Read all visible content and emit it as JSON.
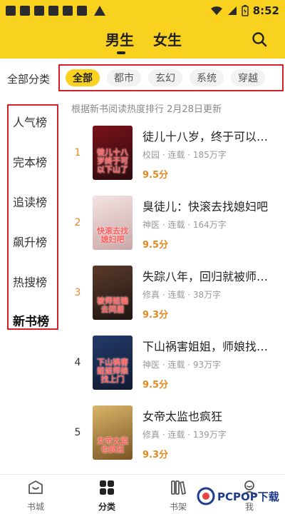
{
  "status_bar": {
    "time": "8:52"
  },
  "header": {
    "tabs": [
      {
        "label": "男生"
      },
      {
        "label": "女生"
      }
    ]
  },
  "categories": {
    "label": "全部分类",
    "chips": [
      "全部",
      "都市",
      "玄幻",
      "系统",
      "穿越"
    ],
    "active": "全部"
  },
  "sidebar": {
    "items": [
      "人气榜",
      "完本榜",
      "追读榜",
      "飙升榜",
      "热搜榜",
      "新书榜"
    ],
    "active": "新书榜"
  },
  "ranking": {
    "note": "根据新书阅读热度排行 2月28日更新",
    "books": [
      {
        "rank": "1",
        "title": "徒儿十八岁，终于可以下山了",
        "meta": "校园 · 连载 · 185万字",
        "score": "9.5分",
        "cover_text": "徒儿十八岁终于可以下山了",
        "cover_colors": [
          "#7a1118",
          "#2a0c10"
        ]
      },
      {
        "rank": "2",
        "title": "臭徒儿：快滚去找媳妇吧",
        "meta": "神医 · 连载 · 164万字",
        "score": "9.5分",
        "cover_text": "快滚去找媳妇吧",
        "cover_colors": [
          "#f4e3e3",
          "#c9a7a7"
        ]
      },
      {
        "rank": "3",
        "title": "失踪八年，回归就被师姐们宠上天",
        "meta": "修真 · 连载 · 38万字",
        "score": "9.3分",
        "cover_text": "被师姐骗去同居",
        "cover_colors": [
          "#5a3a2a",
          "#1e1412"
        ]
      },
      {
        "rank": "4",
        "title": "下山祸害姐姐，师娘找上门",
        "meta": "神医 · 连载 · 93万字",
        "score": "9.5分",
        "cover_text": "下山祸害姐姐师娘找上门",
        "cover_colors": [
          "#243a6a",
          "#101a30"
        ]
      },
      {
        "rank": "5",
        "title": "女帝太监也疯狂",
        "meta": "修真 · 连载 · 139万字",
        "score": "9.3分",
        "cover_text": "女帝太监也疯狂",
        "cover_colors": [
          "#d9b46a",
          "#7a5524"
        ]
      }
    ]
  },
  "bottom_nav": {
    "items": [
      {
        "label": "书城",
        "icon": "book-city-icon"
      },
      {
        "label": "分类",
        "icon": "category-grid-icon"
      },
      {
        "label": "书架",
        "icon": "bookshelf-icon"
      },
      {
        "label": "我",
        "icon": "profile-icon"
      }
    ],
    "active": "分类"
  },
  "watermark": {
    "text": "PCPOP下载"
  },
  "colors": {
    "accent": "#f8d21f",
    "highlight_border": "#d3202a",
    "score": "#e08a21",
    "rank": "#e28a2e"
  }
}
